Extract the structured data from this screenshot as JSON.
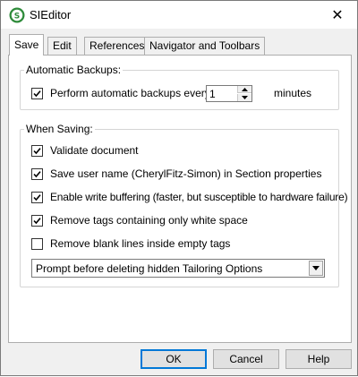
{
  "window": {
    "title": "SIEditor",
    "close_glyph": "✕"
  },
  "tabs": [
    {
      "label": "Save",
      "active": true
    },
    {
      "label": "Edit",
      "active": false
    },
    {
      "label": "References",
      "active": false
    },
    {
      "label": "Navigator and Toolbars",
      "active": false
    }
  ],
  "backups": {
    "group_label": "Automatic Backups:",
    "checkbox_label": "Perform automatic backups every:",
    "checked": true,
    "interval_value": "1",
    "units_label": "minutes"
  },
  "saving": {
    "group_label": "When Saving:",
    "options": [
      {
        "label": "Validate document",
        "checked": true
      },
      {
        "label": "Save user name (CherylFitz-Simon) in Section properties",
        "checked": true
      },
      {
        "label": "Enable write buffering (faster, but susceptible to hardware failure)",
        "checked": true
      },
      {
        "label": "Remove tags containing only white space",
        "checked": true
      },
      {
        "label": "Remove blank lines inside empty tags",
        "checked": false
      }
    ],
    "dropdown_value": "Prompt before deleting hidden Tailoring Options"
  },
  "buttons": {
    "ok": "OK",
    "cancel": "Cancel",
    "help": "Help"
  },
  "colors": {
    "icon_green": "#2e8b3a",
    "accent_blue": "#0078d7"
  }
}
